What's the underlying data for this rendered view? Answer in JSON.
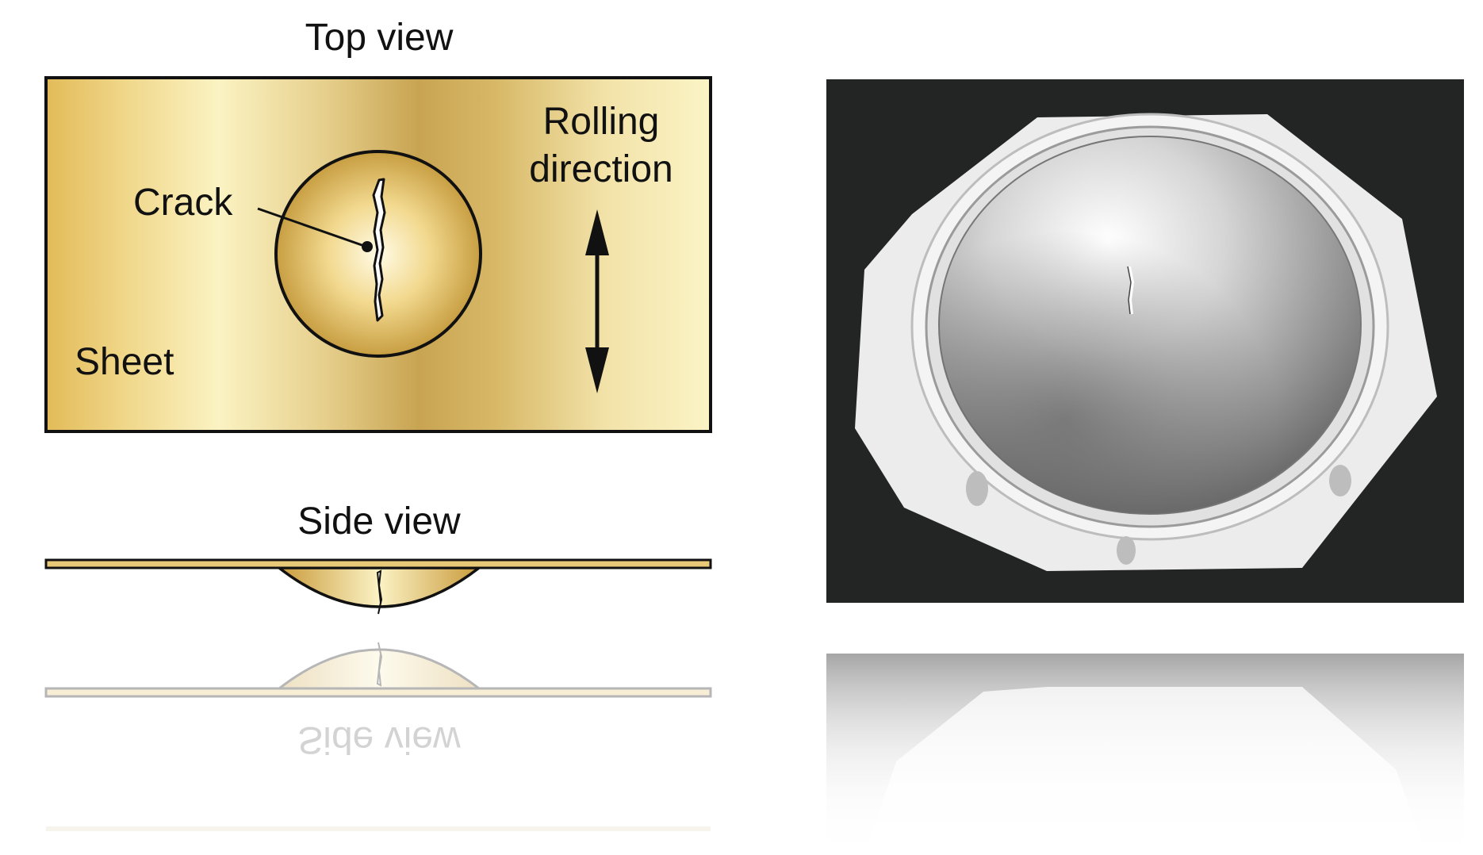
{
  "labels": {
    "top_view": "Top view",
    "side_view": "Side view",
    "crack": "Crack",
    "sheet": "Sheet",
    "rolling_line1": "Rolling",
    "rolling_line2": "direction"
  },
  "colors": {
    "sheet_gold_dark": "#d4a93e",
    "sheet_gold_light": "#f8efb8",
    "photo_background": "#232524",
    "outline": "#111111"
  }
}
